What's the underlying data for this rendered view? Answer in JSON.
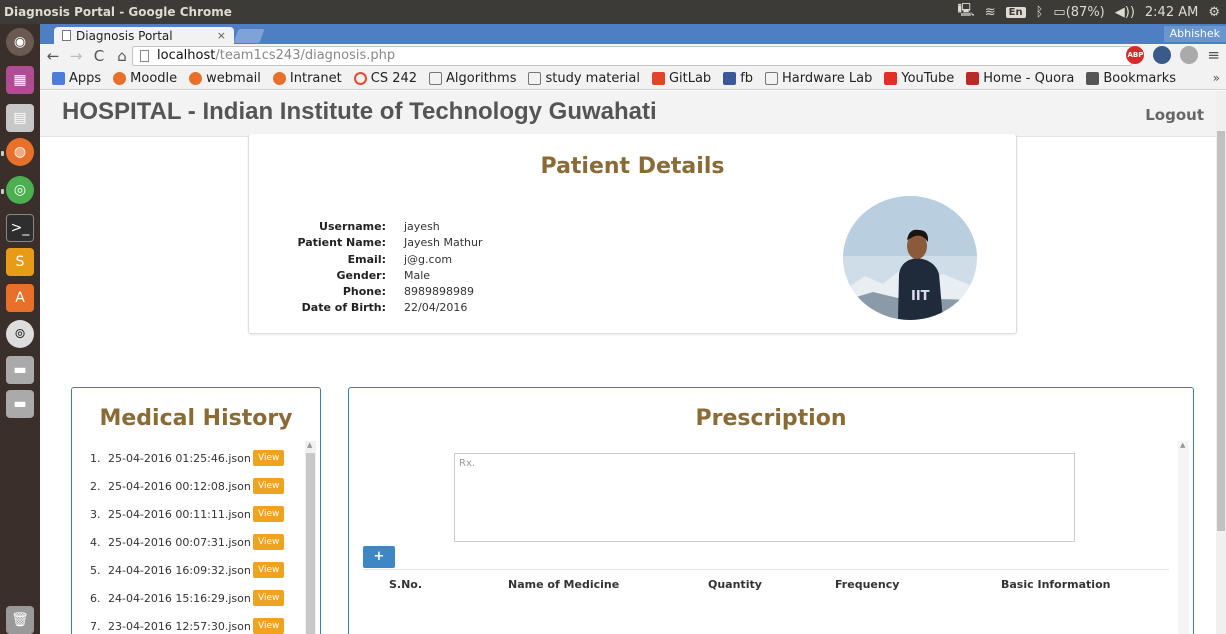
{
  "os": {
    "window_title": "Diagnosis Portal - Google Chrome",
    "keyboard": "En",
    "battery": "(87%)",
    "time": "2:42 AM"
  },
  "browser": {
    "tab_title": "Diagnosis Portal",
    "tab_close": "×",
    "profile": "Abhishek",
    "url_host": "localhost",
    "url_path": "/team1cs243/diagnosis.php",
    "bookmarks": [
      "Apps",
      "Moodle",
      "webmail",
      "Intranet",
      "CS 242",
      "Algorithms",
      "study material",
      "GitLab",
      "fb",
      "Hardware Lab",
      "YouTube",
      "Home - Quora",
      "Bookmarks"
    ],
    "bookmarks_more": "»"
  },
  "header": {
    "title": "HOSPITAL - Indian Institute of Technology Guwahati",
    "logout": "Logout"
  },
  "patient": {
    "title": "Patient Details",
    "labels": {
      "username": "Username:",
      "name": "Patient Name:",
      "email": "Email:",
      "gender": "Gender:",
      "phone": "Phone:",
      "dob": "Date of Birth:"
    },
    "values": {
      "username": "jayesh",
      "name": "Jayesh Mathur",
      "email": "j@g.com",
      "gender": "Male",
      "phone": "8989898989",
      "dob": "22/04/2016"
    }
  },
  "history": {
    "title": "Medical History",
    "view_label": "View",
    "items": [
      {
        "idx": "1.",
        "file": "25-04-2016 01:25:46.json"
      },
      {
        "idx": "2.",
        "file": "25-04-2016 00:12:08.json"
      },
      {
        "idx": "3.",
        "file": "25-04-2016 00:11:11.json"
      },
      {
        "idx": "4.",
        "file": "25-04-2016 00:07:31.json"
      },
      {
        "idx": "5.",
        "file": "24-04-2016 16:09:32.json"
      },
      {
        "idx": "6.",
        "file": "24-04-2016 15:16:29.json"
      },
      {
        "idx": "7.",
        "file": "23-04-2016 12:57:30.json"
      }
    ]
  },
  "prescription": {
    "title": "Prescription",
    "placeholder": "Rx.",
    "add_label": "+",
    "columns": [
      "S.No.",
      "Name of Medicine",
      "Quantity",
      "Frequency",
      "Basic Information"
    ]
  }
}
